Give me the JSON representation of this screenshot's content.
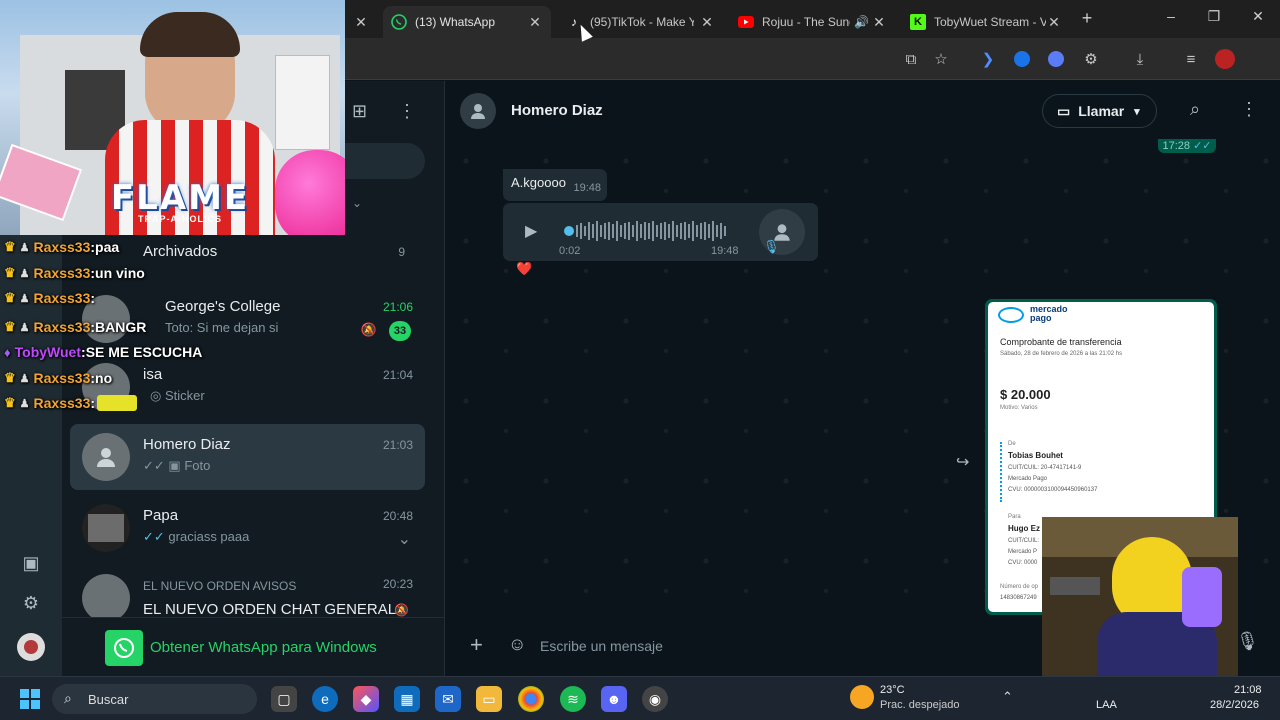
{
  "browser": {
    "tabs": [
      {
        "label": "(13) WhatsApp",
        "active": true,
        "icon": "whatsapp-icon"
      },
      {
        "label": "(95)TikTok - Make Yo",
        "icon": "tiktok-icon"
      },
      {
        "label": "Rojuu - The Sund",
        "icon": "youtube-icon"
      },
      {
        "label": "TobyWuet Stream - V",
        "icon": "kick-icon"
      }
    ],
    "new_tab": "+",
    "window_controls": [
      "–",
      "❐",
      "✕"
    ]
  },
  "whatsapp": {
    "archived": {
      "label": "Archivados",
      "count": "9"
    },
    "chats": [
      {
        "name": "George's College",
        "time": "21:06",
        "snippet": "Toto: Si me dejan si",
        "unread": "33",
        "muted": true
      },
      {
        "name": "isa",
        "time": "21:04",
        "snippet": "Sticker"
      },
      {
        "name": "Homero Diaz",
        "time": "21:03",
        "snippet": "Foto",
        "selected": true
      },
      {
        "name": "Papa",
        "time": "20:48",
        "snippet": "graciass paaa"
      },
      {
        "name": "EL NUEVO ORDEN CHAT GENERAL",
        "time": "20:23",
        "snippet_prefix": "EL NUEVO ORDEN AVISOS"
      }
    ],
    "get_app_banner": "Obtener WhatsApp para Windows",
    "conversation": {
      "contact_name": "Homero Diaz",
      "call_label": "Llamar",
      "prev_time": "17:28",
      "text_message": {
        "text": "A.kgoooo",
        "time": "19:48"
      },
      "voice_note": {
        "elapsed": "0:02",
        "time": "19:48"
      },
      "reaction": "❤️",
      "receipt": {
        "brand_line1": "mercado",
        "brand_line2": "pago",
        "title": "Comprobante de transferencia",
        "date": "Sábado, 28 de febrero de 2026 a las 21:02 hs",
        "amount": "$ 20.000",
        "motivo": "Motivo: Varios",
        "from_label": "De",
        "from_name": "Tobias Bouhet",
        "from_cuit": "CUIT/CUIL: 20-47417141-9",
        "from_bank": "Mercado Pago",
        "from_cvu": "CVU: 0000003100094450960137",
        "to_label": "Para",
        "to_name": "Hugo Ez",
        "to_cuit": "CUIT/CUIL:",
        "to_bank": "Mercado P",
        "to_cvu": "CVU: 0000",
        "op_label": "Número de op",
        "op_number": "14830867249"
      },
      "composer_placeholder": "Escribe un mensaje"
    }
  },
  "stream_overlay": {
    "logo_text": "FLAME",
    "logo_sub": "TRAP-A-HOLICS",
    "chat": [
      {
        "user": "Raxss33",
        "msg": "paa"
      },
      {
        "user": "Raxss33",
        "msg": "un vino"
      },
      {
        "user": "Raxss33",
        "msg": ""
      },
      {
        "user": "Raxss33",
        "msg": "BANGR"
      },
      {
        "user": "TobyWuet",
        "msg": "SE ME ESCUCHA",
        "streamer": true
      },
      {
        "user": "Raxss33",
        "msg": "no"
      },
      {
        "user": "Raxss33",
        "msg": ""
      }
    ]
  },
  "taskbar": {
    "search_label": "Buscar",
    "weather_temp": "23°C",
    "weather_desc": "Prac. despejado",
    "lang": "LAA",
    "time": "21:08",
    "date": "28/2/2026"
  },
  "colors": {
    "wa_green": "#25d366",
    "bubble_in": "#202c33",
    "bubble_out": "#005c4b",
    "mp_blue": "#009ee3"
  }
}
